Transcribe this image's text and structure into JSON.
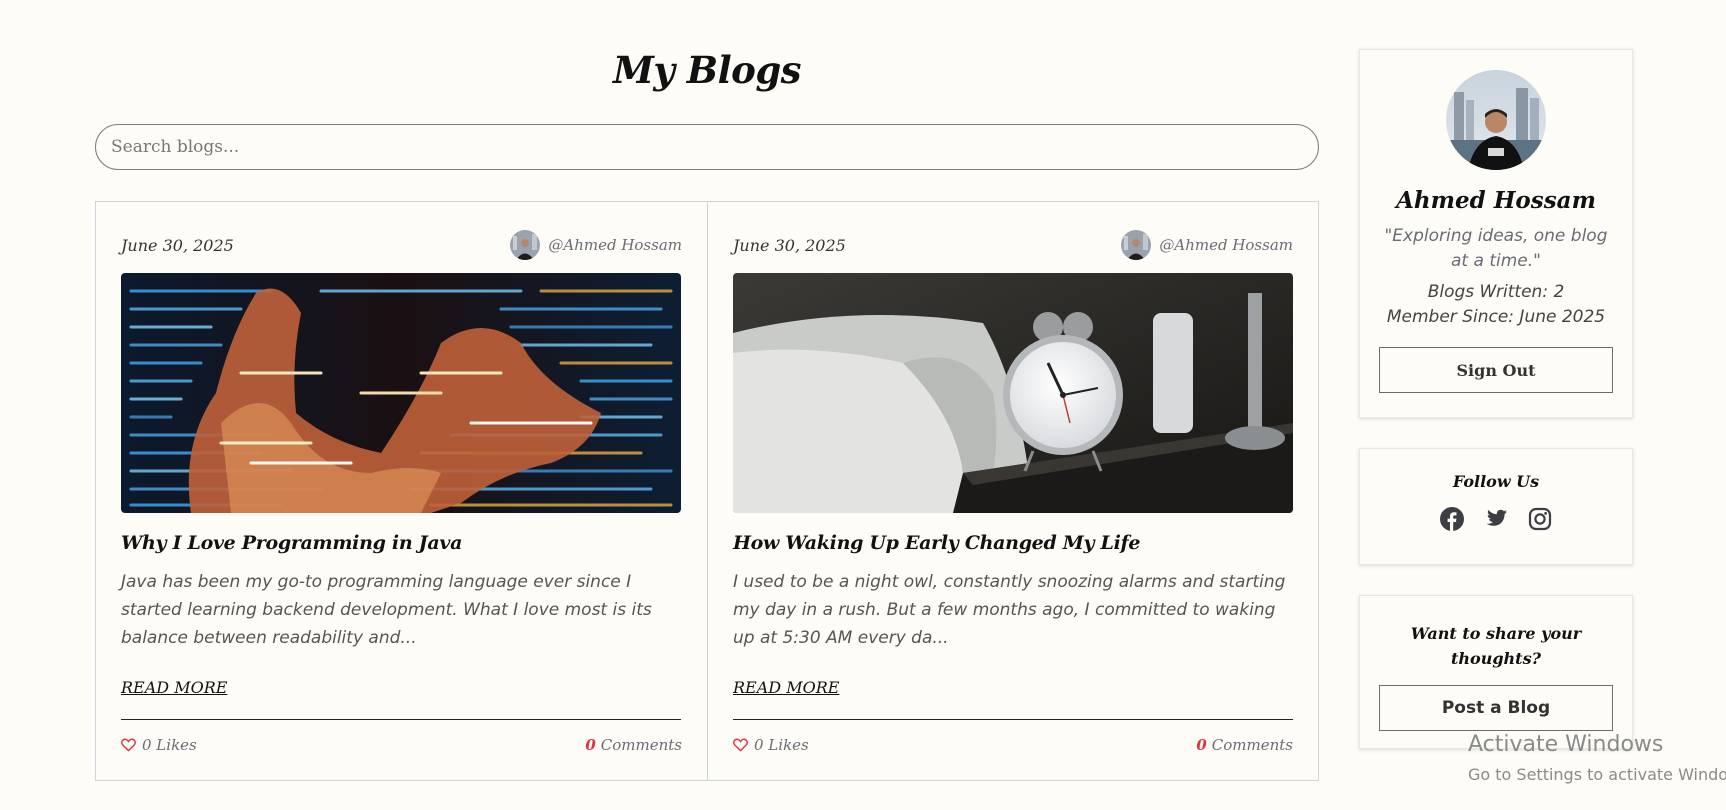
{
  "page": {
    "title": "My Blogs",
    "search_placeholder": "Search blogs..."
  },
  "posts": [
    {
      "date": "June 30, 2025",
      "author": "@Ahmed Hossam",
      "title": "Why I Love Programming in Java",
      "excerpt": "Java has been my go-to programming language ever since I started learning backend development. What I love most is its balance between readability and...",
      "read_more": "READ MORE",
      "likes": "0 Likes",
      "comments_count": "0",
      "comments_label": "Comments",
      "image": "code-projection-photo"
    },
    {
      "date": "June 30, 2025",
      "author": "@Ahmed Hossam",
      "title": "How Waking Up Early Changed My Life",
      "excerpt": "I used to be a night owl, constantly snoozing alarms and starting my day in a rush. But a few months ago, I committed to waking up at 5:30 AM every da...",
      "read_more": "READ MORE",
      "likes": "0 Likes",
      "comments_count": "0",
      "comments_label": "Comments",
      "image": "alarm-clock-bedside-photo"
    }
  ],
  "profile": {
    "name": "Ahmed Hossam",
    "quote": "\"Exploring ideas, one blog at a time.\"",
    "blogs_written": "Blogs Written: 2",
    "member_since": "Member Since: June 2025",
    "sign_out": "Sign Out"
  },
  "follow": {
    "title": "Follow Us",
    "icons": [
      "facebook-icon",
      "twitter-icon",
      "instagram-icon"
    ]
  },
  "share": {
    "title": "Want to share your thoughts?",
    "button": "Post a Blog"
  },
  "watermark": {
    "line1": "Activate Windows",
    "line2": "Go to Settings to activate Windows."
  },
  "colors": {
    "background": "#fdfcf7",
    "accent_red": "#e0323e",
    "muted_text": "#6b6b75"
  }
}
